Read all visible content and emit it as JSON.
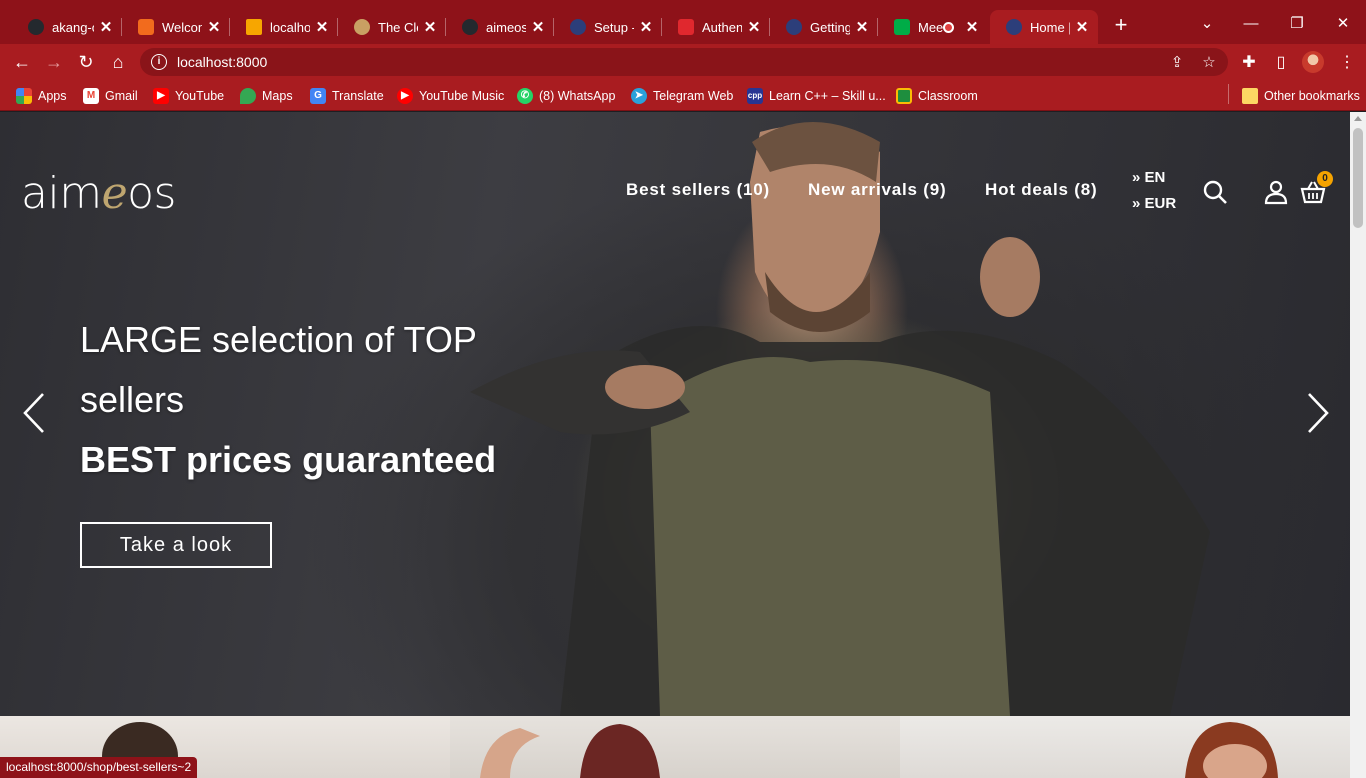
{
  "browser": {
    "tabs": [
      {
        "title": "akang-o",
        "favicon_color": "#24292e"
      },
      {
        "title": "Welcome",
        "favicon_color": "#f26b1d"
      },
      {
        "title": "localhost",
        "favicon_color": "#f7a600"
      },
      {
        "title": "The Clou",
        "favicon_color": "#c9a063"
      },
      {
        "title": "aimeos/a",
        "favicon_color": "#24292e"
      },
      {
        "title": "Setup - A",
        "favicon_color": "#2c3e7a"
      },
      {
        "title": "Authenti",
        "favicon_color": "#e0282e"
      },
      {
        "title": "Getting",
        "favicon_color": "#2c3e7a"
      },
      {
        "title": "Mee",
        "favicon_color": "#00ac47"
      },
      {
        "title": "Home | I",
        "favicon_color": "#2c3e7a"
      }
    ],
    "new_tab": "+",
    "window": {
      "minimize": "—",
      "restore": "❐",
      "close": "✕",
      "tab_search": "⌄"
    },
    "url": "localhost:8000",
    "bookmarks": [
      {
        "label": "Apps",
        "color": "#f4b400"
      },
      {
        "label": "Gmail",
        "color": "#ea4335"
      },
      {
        "label": "YouTube",
        "color": "#ff0000"
      },
      {
        "label": "Maps",
        "color": "#34a853"
      },
      {
        "label": "Translate",
        "color": "#4285f4"
      },
      {
        "label": "YouTube Music",
        "color": "#ff0000"
      },
      {
        "label": "(8) WhatsApp",
        "color": "#25d366"
      },
      {
        "label": "Telegram Web",
        "color": "#2aa1da"
      },
      {
        "label": "Learn C++ – Skill u...",
        "color": "#283593"
      },
      {
        "label": "Classroom",
        "color": "#1e8e3e"
      }
    ],
    "other_bookmarks": "Other bookmarks",
    "status_url": "localhost:8000/shop/best-sellers~2"
  },
  "site": {
    "logo_pre": "aim",
    "logo_e": "e",
    "logo_post": "os",
    "menu": [
      "Best sellers (10)",
      "New arrivals (9)",
      "Hot deals (8)"
    ],
    "language": "» EN",
    "currency": "» EUR",
    "cart_count": "0"
  },
  "hero": {
    "line1": "LARGE selection of TOP",
    "line2": "sellers",
    "line3": "BEST prices guaranteed",
    "cta": "Take a look"
  },
  "colors": {
    "chrome": "#a91c20",
    "logo_accent": "#bfa670",
    "badge": "#f5a300"
  }
}
